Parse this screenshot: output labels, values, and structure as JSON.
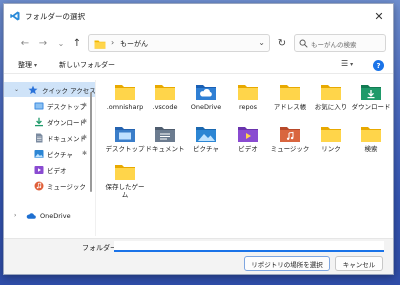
{
  "window": {
    "title": "フォルダーの選択",
    "close_label": "✕"
  },
  "nav": {
    "back": "←",
    "forward": "→",
    "recent": "⌄",
    "up": "↑",
    "address_separator": "›",
    "address_path": "もーがん",
    "address_dropdown": "⌄",
    "refresh": "↻",
    "search_placeholder": "もーがんの検索"
  },
  "toolbar": {
    "organize": "整理",
    "new_folder": "新しいフォルダー",
    "view": "☰",
    "help": "?"
  },
  "sidebar": {
    "items": [
      {
        "label": "クイック アクセス",
        "icon": "star-icon",
        "pinned": false
      },
      {
        "label": "デスクトップ",
        "icon": "desktop-icon",
        "pinned": true
      },
      {
        "label": "ダウンロード",
        "icon": "download-icon",
        "pinned": true
      },
      {
        "label": "ドキュメント",
        "icon": "document-icon",
        "pinned": true
      },
      {
        "label": "ピクチャ",
        "icon": "picture-icon",
        "pinned": true
      },
      {
        "label": "ビデオ",
        "icon": "video-icon",
        "pinned": false
      },
      {
        "label": "ミュージック",
        "icon": "music-icon",
        "pinned": false
      },
      {
        "label": "OneDrive",
        "icon": "cloud-icon",
        "pinned": false
      }
    ],
    "pin_glyph": "📌"
  },
  "folders": [
    {
      "label": ".omnisharp",
      "icon": "folder-icon",
      "color": "#f7c948"
    },
    {
      "label": ".vscode",
      "icon": "folder-icon",
      "color": "#f7c948"
    },
    {
      "label": "OneDrive",
      "icon": "onedrive-folder-icon",
      "color": "#2f7fd4"
    },
    {
      "label": "repos",
      "icon": "folder-icon",
      "color": "#f7c948"
    },
    {
      "label": "アドレス帳",
      "icon": "folder-icon",
      "color": "#f7c948"
    },
    {
      "label": "お気に入り",
      "icon": "folder-icon",
      "color": "#f7c948"
    },
    {
      "label": "ダウンロード",
      "icon": "download-folder-icon",
      "color": "#1f9a6a"
    },
    {
      "label": "デスクトップ",
      "icon": "desktop-folder-icon",
      "color": "#3a7dc9"
    },
    {
      "label": "ドキュメント",
      "icon": "document-folder-icon",
      "color": "#6b7b8f"
    },
    {
      "label": "ピクチャ",
      "icon": "picture-folder-icon",
      "color": "#2c86d4"
    },
    {
      "label": "ビデオ",
      "icon": "video-folder-icon",
      "color": "#8a4bd1"
    },
    {
      "label": "ミュージック",
      "icon": "music-folder-icon",
      "color": "#d9663f"
    },
    {
      "label": "リンク",
      "icon": "folder-icon",
      "color": "#f7c948"
    },
    {
      "label": "検索",
      "icon": "folder-icon",
      "color": "#f7c948"
    },
    {
      "label": "保存したゲーム",
      "icon": "folder-icon",
      "color": "#f7c948"
    }
  ],
  "footer": {
    "folder_label": "フォルダー:",
    "folder_value": "",
    "select_button": "リポジトリの場所を選択",
    "cancel_button": "キャンセル"
  }
}
